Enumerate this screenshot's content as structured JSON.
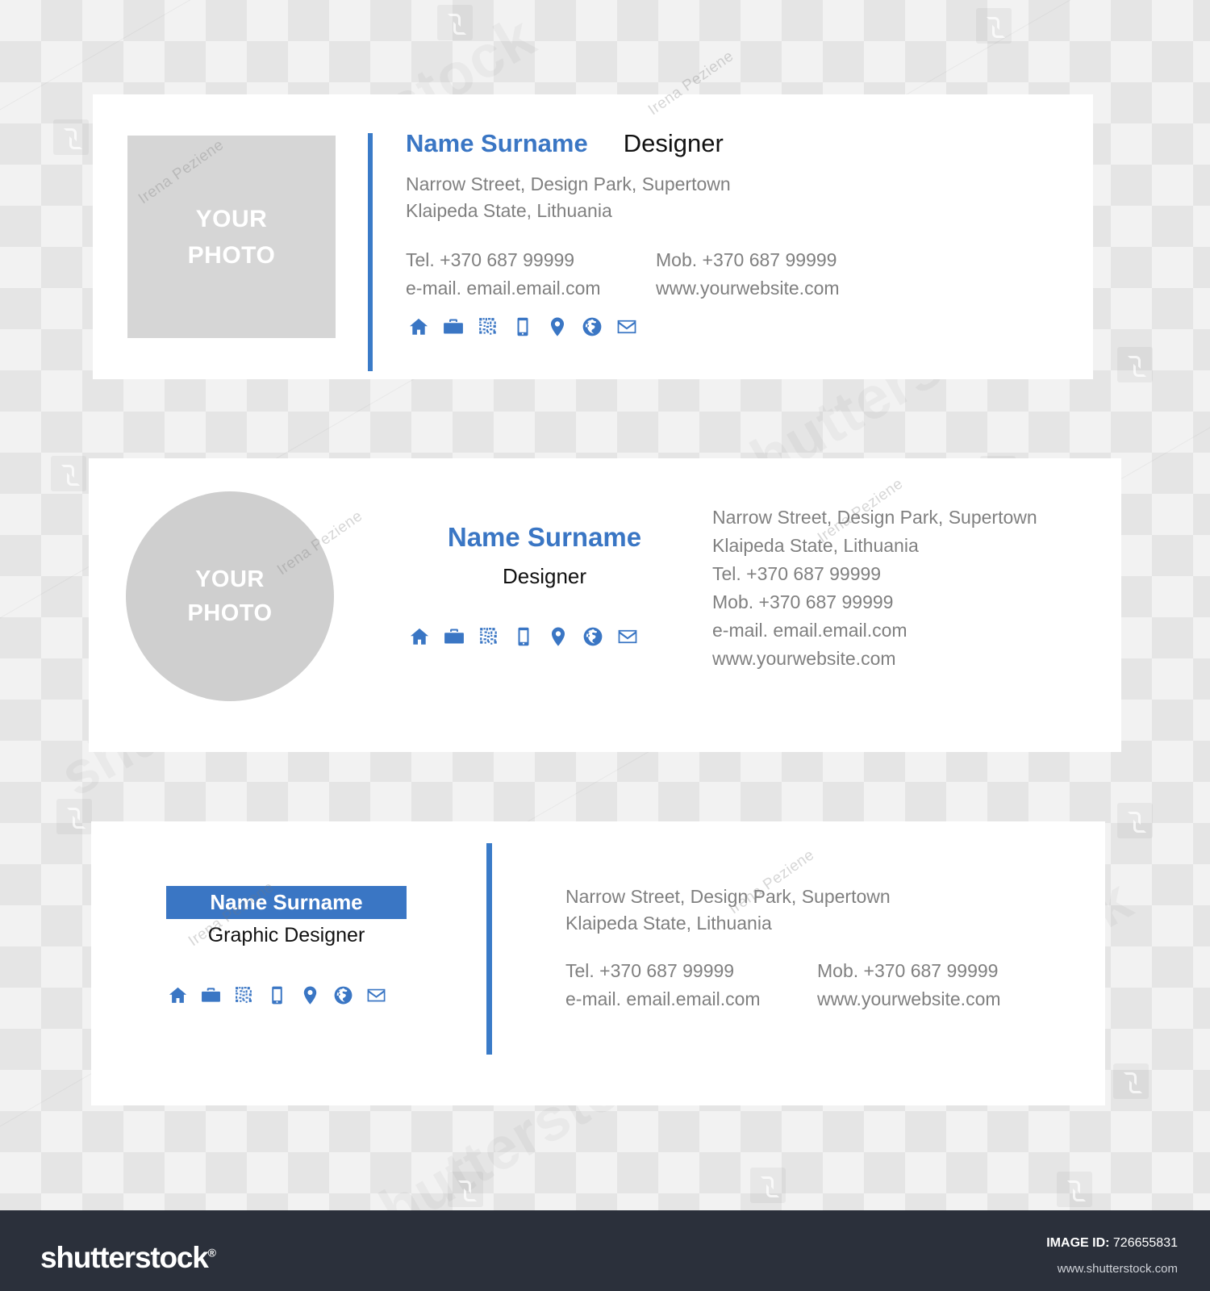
{
  "canvas": {
    "background_style": "transparency-checkerboard",
    "checker_light": "#f2f2f2",
    "checker_dark": "#e5e5e5"
  },
  "theme": {
    "accent_blue": "#3a76c4",
    "rule_blue": "#3a7bc8",
    "body_gray": "#808080",
    "photo_gray": "#d6d6d6",
    "footer_dark": "#2b303b"
  },
  "watermarks": {
    "brand_text": "shutterstock",
    "author_text": "Irena Peziene"
  },
  "icons": [
    {
      "name": "home-icon",
      "label": "Home"
    },
    {
      "name": "briefcase-icon",
      "label": "Briefcase"
    },
    {
      "name": "qr-code-icon",
      "label": "QR Code"
    },
    {
      "name": "mobile-phone-icon",
      "label": "Mobile phone"
    },
    {
      "name": "location-pin-icon",
      "label": "Location"
    },
    {
      "name": "globe-icon",
      "label": "Website"
    },
    {
      "name": "envelope-icon",
      "label": "E-mail"
    }
  ],
  "cards": [
    {
      "id": "card1",
      "layout": "square-photo-left",
      "photo_placeholder": {
        "line1": "YOUR",
        "line2": "PHOTO"
      },
      "name": "Name Surname",
      "role": "Designer",
      "address_line1": "Narrow Street, Design Park, Supertown",
      "address_line2": "Klaipeda State, Lithuania",
      "contacts": {
        "tel": "Tel. +370 687 99999",
        "mob": "Mob. +370 687 99999",
        "email": "e-mail. email.email.com",
        "website": "www.yourwebsite.com"
      }
    },
    {
      "id": "card2",
      "layout": "circle-photo-left",
      "photo_placeholder": {
        "line1": "YOUR",
        "line2": "PHOTO"
      },
      "name": "Name Surname",
      "role": "Designer",
      "address_line1": "Narrow Street, Design Park, Supertown",
      "address_line2": "Klaipeda State, Lithuania",
      "contacts": {
        "tel": "Tel. +370 687 99999",
        "mob": "Mob. +370 687 99999",
        "email": "e-mail. email.email.com",
        "website": "www.yourwebsite.com"
      }
    },
    {
      "id": "card3",
      "layout": "banner-name-left",
      "name": "Name Surname",
      "role": "Graphic Designer",
      "address_line1": "Narrow Street, Design Park, Supertown",
      "address_line2": "Klaipeda State, Lithuania",
      "contacts": {
        "tel": "Tel. +370 687 99999",
        "mob": "Mob. +370 687 99999",
        "email": "e-mail. email.email.com",
        "website": "www.yourwebsite.com"
      }
    }
  ],
  "footer": {
    "logo_text": "shutterstock",
    "logo_mark": "®",
    "image_id_label": "IMAGE ID:",
    "image_id_value": "726655831",
    "url": "www.shutterstock.com"
  }
}
